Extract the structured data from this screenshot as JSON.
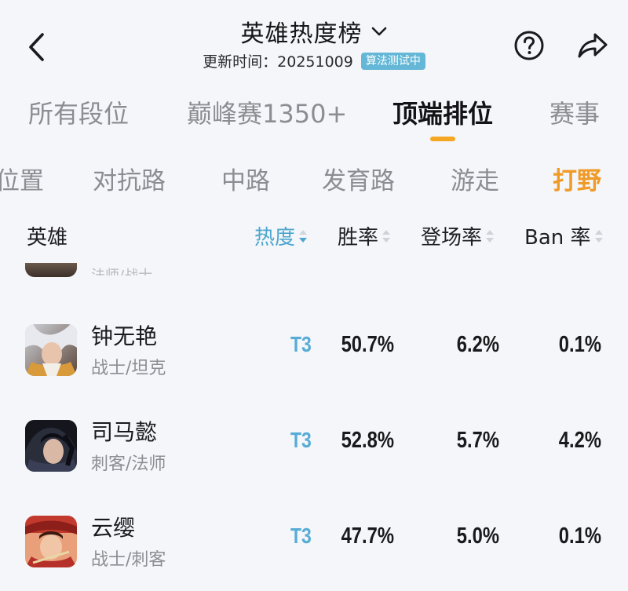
{
  "header": {
    "title": "英雄热度榜",
    "update_text": "更新时间：20251009",
    "algo_badge": "算法测试中"
  },
  "tabs": [
    {
      "label": "所有段位",
      "active": false
    },
    {
      "label": "巅峰赛1350+",
      "active": false
    },
    {
      "label": "顶端排位",
      "active": true
    },
    {
      "label": "赛事",
      "active": false
    }
  ],
  "positions": [
    {
      "label": "位置",
      "active": false
    },
    {
      "label": "对抗路",
      "active": false
    },
    {
      "label": "中路",
      "active": false
    },
    {
      "label": "发育路",
      "active": false
    },
    {
      "label": "游走",
      "active": false
    },
    {
      "label": "打野",
      "active": true
    }
  ],
  "columns": {
    "hero": "英雄",
    "heat": "热度",
    "win": "胜率",
    "appear": "登场率",
    "ban": "Ban 率",
    "sorted_by": "热度",
    "sort_direction": "descending"
  },
  "partial_row": {
    "role": "法师/战士"
  },
  "rows": [
    {
      "name": "钟无艳",
      "role": "战士/坦克",
      "tier": "T3",
      "win": "50.7%",
      "appear": "6.2%",
      "ban": "0.1%"
    },
    {
      "name": "司马懿",
      "role": "刺客/法师",
      "tier": "T3",
      "win": "52.8%",
      "appear": "5.7%",
      "ban": "4.2%"
    },
    {
      "name": "云缨",
      "role": "战士/刺客",
      "tier": "T3",
      "win": "47.7%",
      "appear": "5.0%",
      "ban": "0.1%"
    }
  ],
  "colors": {
    "accent_orange": "#f5a623",
    "tier_blue": "#57acd6",
    "selected_header": "#4da6cf",
    "background": "#f4f6f9"
  }
}
